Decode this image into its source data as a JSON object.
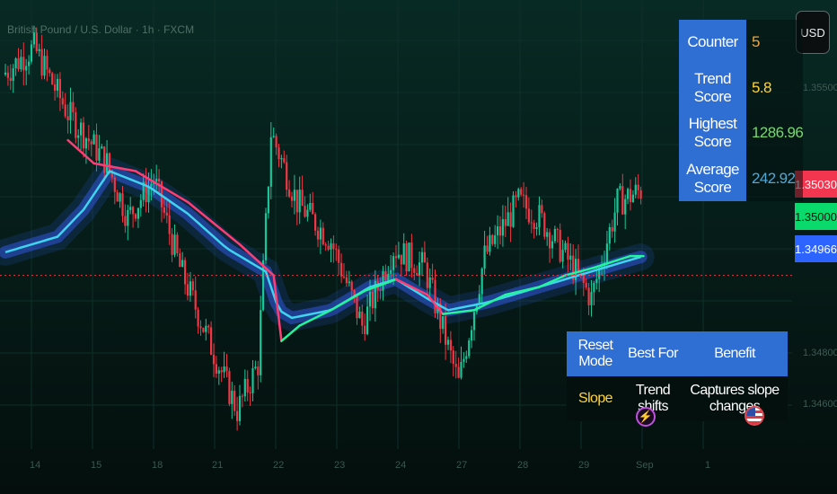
{
  "header": {
    "symbol": "British Pound / U.S. Dollar · 1h · FXCM"
  },
  "currency_button": "USD",
  "price_labels": {
    "current": "1.35030",
    "green_line": "1.35000",
    "blue_line": "1.34966"
  },
  "y_axis_labels": [
    "1.35500",
    "1.34800",
    "1.34600"
  ],
  "x_axis_labels": [
    "14",
    "15",
    "18",
    "21",
    "22",
    "23",
    "24",
    "27",
    "28",
    "29",
    "Sep",
    "1"
  ],
  "stats_table": {
    "rows": [
      {
        "label": "Counter",
        "value": "5"
      },
      {
        "label": "Trend Score",
        "value": "5.8"
      },
      {
        "label": "Highest Score",
        "value": "1286.96"
      },
      {
        "label": "Average Score",
        "value": "242.92"
      }
    ]
  },
  "mode_table": {
    "headers": [
      "Reset Mode",
      "Best For",
      "Benefit"
    ],
    "row": [
      "Slope",
      "Trend shifts",
      "Captures slope changes"
    ]
  },
  "icons": {
    "event_1": "lightning-icon",
    "event_2": "us-flag-icon"
  },
  "colors": {
    "up": "#16c79a",
    "down": "#f23645",
    "band": "#2f56d8",
    "trend_up": "#23f59a",
    "trend_down": "#ff3d73",
    "trend_cyan": "#3fd3ee",
    "table_header": "#2f6ed2",
    "value_orange": "#f2a43a",
    "value_yellow": "#ffd43b",
    "value_green": "#78d870"
  },
  "chart_data": {
    "type": "candlestick",
    "price_range": [
      1.3465,
      1.3565
    ],
    "candle_count": 245,
    "waypoints": [
      [
        0,
        1.3555
      ],
      [
        12,
        1.3562
      ],
      [
        25,
        1.3545
      ],
      [
        40,
        1.3532
      ],
      [
        48,
        1.3518
      ],
      [
        58,
        1.3528
      ],
      [
        68,
        1.3505
      ],
      [
        78,
        1.3488
      ],
      [
        90,
        1.3468
      ],
      [
        98,
        1.348
      ],
      [
        103,
        1.354
      ],
      [
        113,
        1.3522
      ],
      [
        126,
        1.3512
      ],
      [
        138,
        1.349
      ],
      [
        150,
        1.351
      ],
      [
        162,
        1.3505
      ],
      [
        175,
        1.3475
      ],
      [
        185,
        1.3508
      ],
      [
        198,
        1.3522
      ],
      [
        206,
        1.3518
      ],
      [
        219,
        1.3505
      ],
      [
        226,
        1.3497
      ],
      [
        236,
        1.3522
      ],
      [
        245,
        1.3525
      ]
    ],
    "current_price": 1.3503,
    "series": [
      {
        "name": "trend_line",
        "points": [
          [
            24,
            1.3538
          ],
          [
            34,
            1.3532
          ],
          [
            50,
            1.353
          ],
          [
            70,
            1.3522
          ],
          [
            90,
            1.3511
          ],
          [
            103,
            1.3503
          ],
          [
            106,
            1.3486
          ],
          [
            113,
            1.349
          ],
          [
            125,
            1.3494
          ],
          [
            138,
            1.3499
          ],
          [
            150,
            1.3502
          ],
          [
            162,
            1.3498
          ],
          [
            168,
            1.3493
          ],
          [
            180,
            1.3494
          ],
          [
            192,
            1.3498
          ],
          [
            205,
            1.35
          ],
          [
            215,
            1.3503
          ],
          [
            226,
            1.3505
          ],
          [
            240,
            1.3508
          ],
          [
            245,
            1.3508
          ]
        ]
      },
      {
        "name": "band_center",
        "points": [
          [
            0,
            1.3509
          ],
          [
            20,
            1.3513
          ],
          [
            30,
            1.352
          ],
          [
            40,
            1.353
          ],
          [
            55,
            1.3526
          ],
          [
            70,
            1.3519
          ],
          [
            85,
            1.351
          ],
          [
            100,
            1.3504
          ],
          [
            105,
            1.3494
          ],
          [
            110,
            1.3492
          ],
          [
            125,
            1.3494
          ],
          [
            140,
            1.35
          ],
          [
            150,
            1.3502
          ],
          [
            162,
            1.3497
          ],
          [
            170,
            1.3494
          ],
          [
            185,
            1.3496
          ],
          [
            200,
            1.3499
          ],
          [
            215,
            1.3502
          ],
          [
            230,
            1.3505
          ],
          [
            245,
            1.3508
          ]
        ]
      }
    ]
  }
}
